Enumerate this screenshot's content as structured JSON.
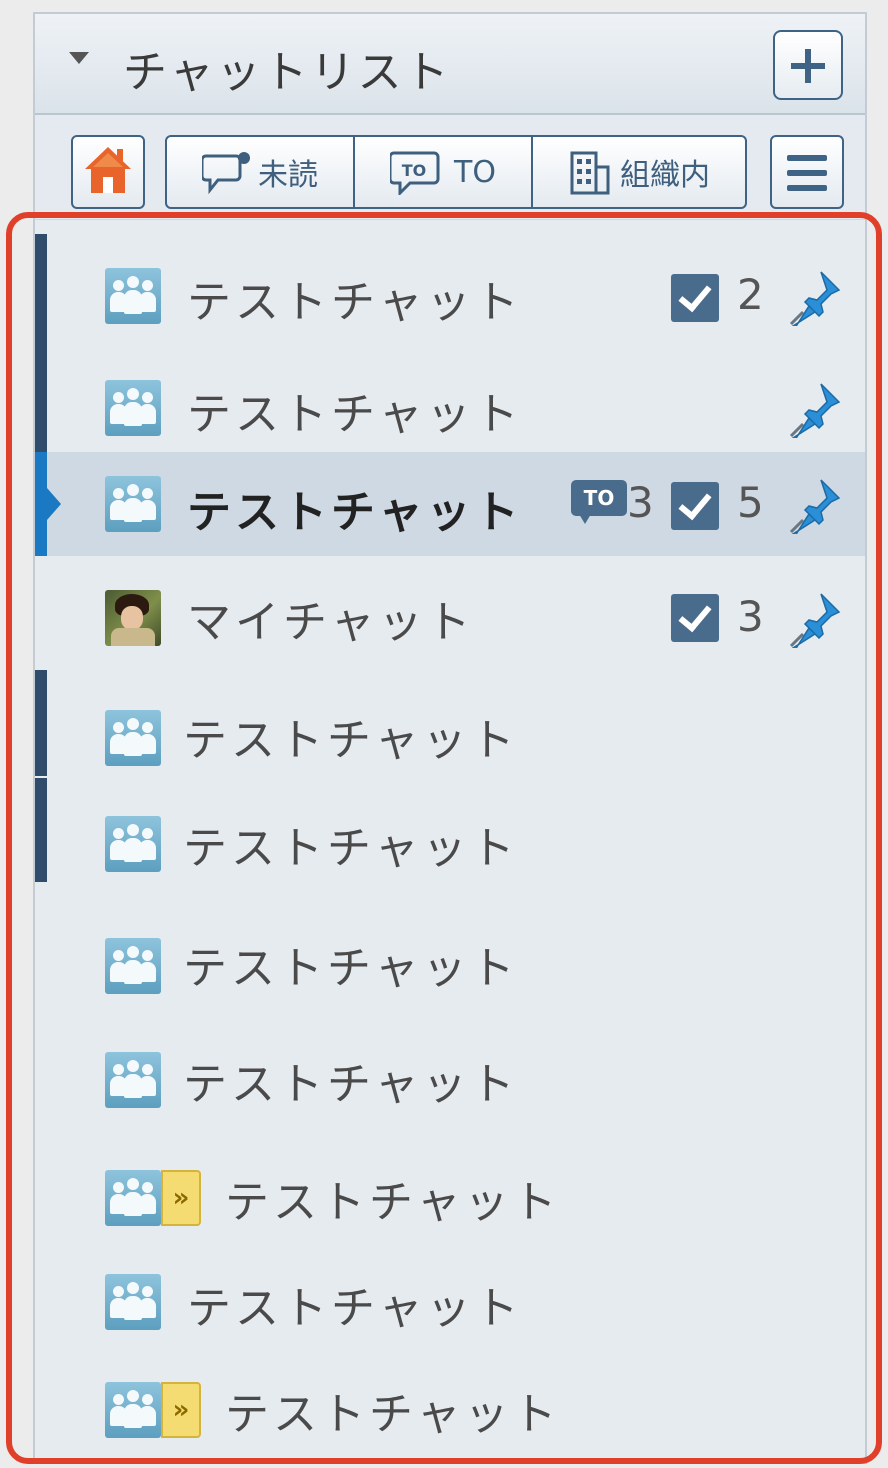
{
  "header": {
    "title": "チャットリスト"
  },
  "toolbar": {
    "filters": [
      {
        "label": "未読",
        "icon": "unread-speech-icon"
      },
      {
        "label": "TO",
        "icon": "to-speech-icon"
      },
      {
        "label": "組織内",
        "icon": "building-icon"
      }
    ]
  },
  "chats": [
    {
      "name": "テストチャット",
      "task_count": "2",
      "pinned": true,
      "unread": true
    },
    {
      "name": "テストチャット",
      "pinned": true,
      "unread": true
    },
    {
      "name": "テストチャット",
      "to_badge": "TO",
      "to_count": "3",
      "task_count": "5",
      "pinned": true,
      "selected": true
    },
    {
      "name": "マイチャット",
      "task_count": "3",
      "pinned": true,
      "avatar": "photo"
    },
    {
      "name": "テストチャット",
      "unread": true
    },
    {
      "name": "テストチャット",
      "unread": true
    },
    {
      "name": "テストチャット"
    },
    {
      "name": "テストチャット"
    },
    {
      "name": "テストチャット",
      "external_mark": "»"
    },
    {
      "name": "テストチャット"
    },
    {
      "name": "テストチャット",
      "external_mark": "»"
    }
  ],
  "colors": {
    "accent": "#3e6385",
    "selected_indicator": "#1b78c2",
    "highlight_border": "#e0402a",
    "pin": "#2a8fd6"
  }
}
